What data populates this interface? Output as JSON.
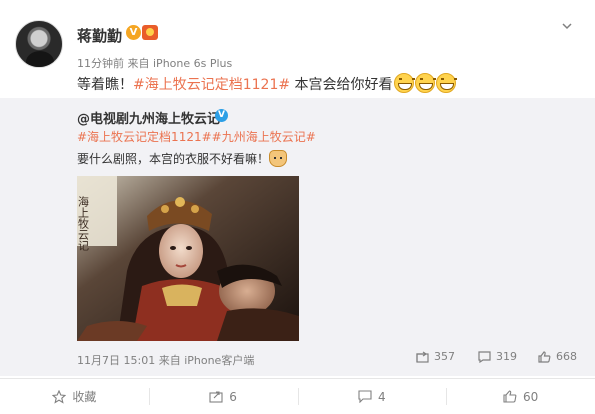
{
  "post": {
    "username": "蒋勤勤",
    "verified_badge": "V",
    "time": "11分钟前",
    "source_prefix": "来自",
    "source": "iPhone 6s Plus",
    "text_prefix": "等着瞧！",
    "hashtag": "#海上牧云记定档1121#",
    "text_suffix": " 本宫会给你好看",
    "emoji": "grin-emoji"
  },
  "repost": {
    "username": "@电视剧九州海上牧云记",
    "verified_badge": "V",
    "hashtags": "#海上牧云记定档1121##九州海上牧云记#",
    "text": "要什么剧照，本宫的衣服不好看嘛！",
    "emoji": "dog-emoji",
    "image_poster_text": "海上牧云记",
    "meta_date": "11月7日 15:01",
    "meta_source": "来自 iPhone客户端",
    "shares": "357",
    "comments": "319",
    "likes": "668"
  },
  "bottom_bar": {
    "collect_label": "收藏",
    "share_count": "6",
    "comment_count": "4",
    "like_count": "60"
  },
  "colors": {
    "hashtag": "#eb7350",
    "repost_bg": "#f2f2f5",
    "meta_text": "#808080"
  }
}
